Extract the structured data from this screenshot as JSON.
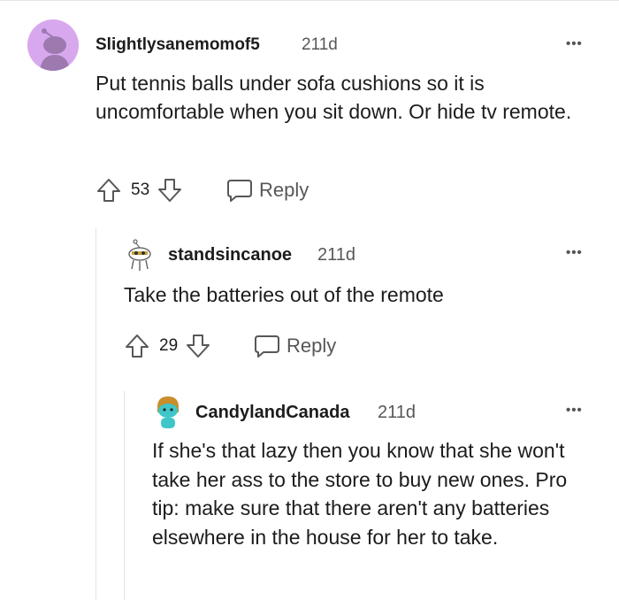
{
  "comments": [
    {
      "username": "Slightlysanemomof5",
      "age": "211d",
      "body": "Put tennis balls under sofa cushions so it is uncomfortable when you sit down. Or hide tv remote.",
      "votes": "53",
      "reply_label": "Reply",
      "more_label": "•••"
    },
    {
      "username": "standsincanoe",
      "age": "211d",
      "body": "Take the batteries out of the remote",
      "votes": "29",
      "reply_label": "Reply",
      "more_label": "•••"
    },
    {
      "username": "CandylandCanada",
      "age": "211d",
      "body": "If she's that lazy then you know that she won't take her ass to the store to buy new ones. Pro tip: make sure that there aren't any batteries elsewhere in the house for her to take.",
      "more_label": "•••"
    }
  ],
  "colors": {
    "avatar_bg": "#d8a8ef",
    "avatar_figure": "#9c7ab0",
    "candyland_avatar": "#3ec6c9",
    "candyland_hair": "#c98e2a"
  }
}
